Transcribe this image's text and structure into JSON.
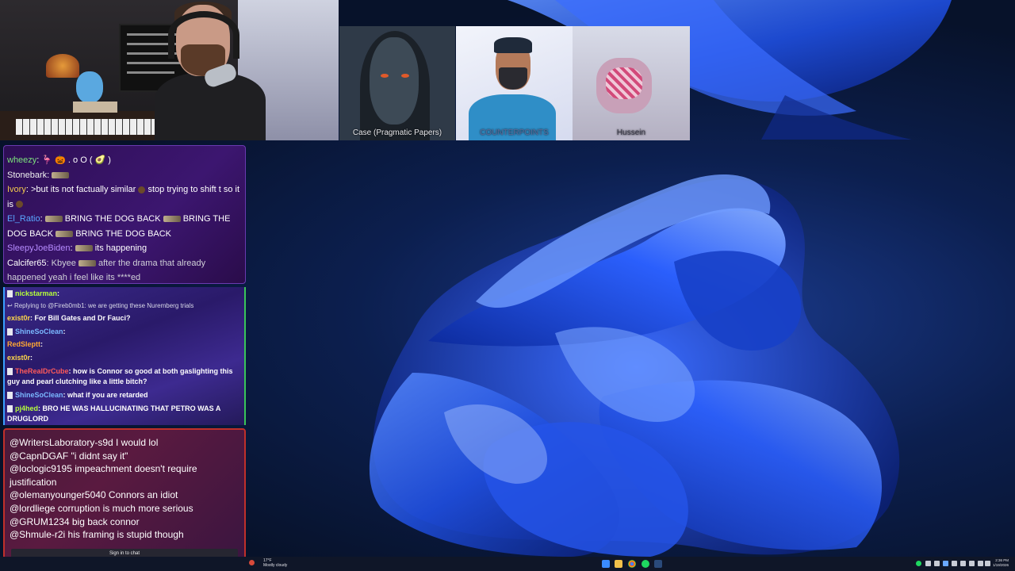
{
  "guests": [
    {
      "label": "Case (Pragmatic Papers)"
    },
    {
      "label": "COUNTERPOINTS"
    },
    {
      "label": "Hussein"
    }
  ],
  "chat_top": [
    {
      "user": "wheezy",
      "text": "🦩 🎃 . o O ( 🥑 )"
    },
    {
      "user": "Stonebark",
      "text": ""
    },
    {
      "user": "Ivory",
      "text": ">but its not factually similar",
      "text2": "stop trying to shift t so it is"
    },
    {
      "user": "El_Ratio",
      "text": "BRING THE DOG BACK",
      "text2": "BRING THE DOG BACK",
      "text3": "BRING THE DOG BACK"
    },
    {
      "user": "SleepyJoeBiden",
      "text": "its happening"
    },
    {
      "user": "Calcifer65",
      "text": "Kbyee",
      "text2": "after the drama that already happened yeah i feel like its ****ed"
    }
  ],
  "chat_mid": [
    {
      "user": "nickstarman",
      "text": ""
    },
    {
      "reply": "Replying to @Fireb0mb1: we are getting these Nuremberg trials"
    },
    {
      "user": "exist0r",
      "text": "For Bill Gates and Dr Fauci?"
    },
    {
      "user": "ShineSoClean",
      "text": ""
    },
    {
      "user": "RedSleptt",
      "text": ""
    },
    {
      "user": "exist0r",
      "text": ""
    },
    {
      "user": "TheRealDrCube",
      "text": "how is Connor so good at both gaslighting this guy and pearl clutching like a little bitch?"
    },
    {
      "user": "ShineSoClean",
      "text": "what if you are retarded"
    },
    {
      "user": "pj4hed",
      "text": "BRO HE WAS HALLUCINATING THAT PETRO WAS A DRUGLORD"
    }
  ],
  "chat_bottom": [
    "@WritersLaboratory-s9d I would lol",
    "@CapnDGAF \"i didnt say it\"",
    "@loclogic9195 impeachment doesn't require justification",
    "@olemanyounger5040 Connors an idiot",
    "@lordliege corruption is much more serious",
    "@GRUM1234 big back connor",
    "@Shmule-r2i his framing is stupid though"
  ],
  "chat_signin": "Sign in to chat",
  "weather": {
    "temp": "17°F",
    "desc": "Mostly cloudy"
  },
  "clock": {
    "time": "2:36 PM",
    "date": "1/19/2026"
  },
  "colors": {
    "accent": "#2f6cff",
    "taskbar": "#0f1628"
  }
}
